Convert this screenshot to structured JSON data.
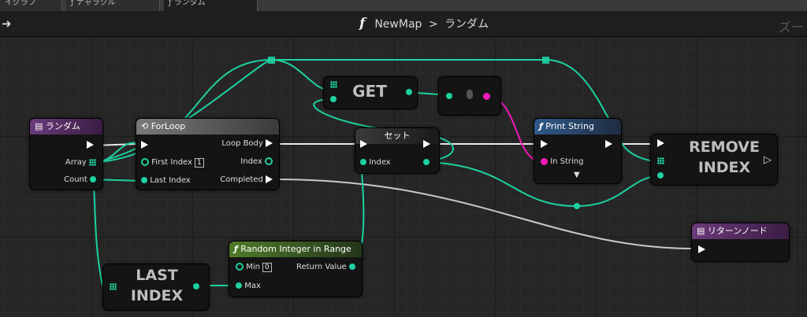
{
  "tabs": [
    {
      "label": "イグラフ"
    },
    {
      "label": "ナャラクル"
    },
    {
      "label": "ランダム"
    }
  ],
  "header": {
    "breadcrumb_root": "NewMap",
    "breadcrumb_sep": ">",
    "breadcrumb_current": "ランダム",
    "zoom": "ズー"
  },
  "colors": {
    "int_wire": "#1dd1a1",
    "exec_wire": "#e8e8e8",
    "string_wire": "#f21ab9",
    "function_header": "#4b6b26",
    "entry_header": "#5b2d6b",
    "forloop_header": "#6a6a6a",
    "print_header": "#2b4a6e"
  },
  "nodes": {
    "entry": {
      "title": "ランダム",
      "array_label": "Array",
      "count_label": "Count"
    },
    "forloop": {
      "title": "ForLoop",
      "first_index_label": "First Index",
      "first_index_value": "1",
      "last_index_label": "Last Index",
      "loop_body_label": "Loop Body",
      "index_label": "Index",
      "completed_label": "Completed"
    },
    "get": {
      "title": "GET"
    },
    "set": {
      "title": "セット",
      "index_label": "Index"
    },
    "print": {
      "title": "Print String",
      "in_string_label": "In String"
    },
    "remove": {
      "title_line1": "REMOVE",
      "title_line2": "INDEX"
    },
    "return": {
      "title": "リターンノード"
    },
    "random": {
      "title": "Random Integer in Range",
      "min_label": "Min",
      "min_value": "0",
      "max_label": "Max",
      "return_label": "Return Value"
    },
    "lastindex": {
      "title_line1": "LAST",
      "title_line2": "INDEX"
    }
  }
}
